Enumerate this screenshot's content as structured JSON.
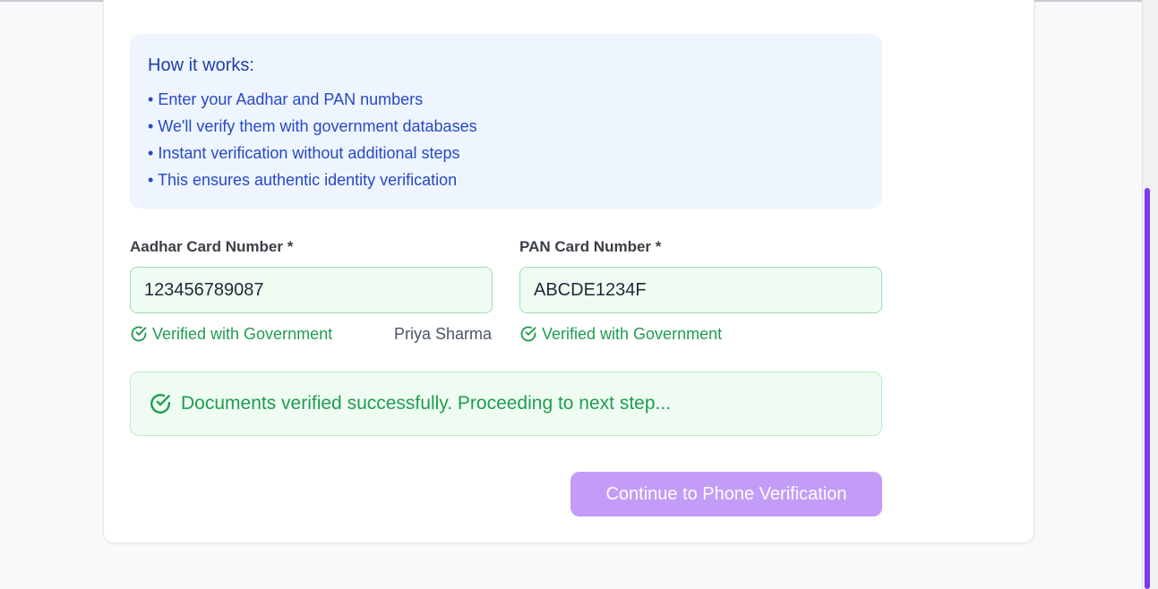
{
  "info": {
    "title": "How it works:",
    "items": [
      "Enter your Aadhar and PAN numbers",
      "We'll verify them with government databases",
      "Instant verification without additional steps",
      "This ensures authentic identity verification"
    ]
  },
  "aadhar": {
    "label": "Aadhar Card Number *",
    "value": "123456789087",
    "status": "Verified with Government",
    "name": "Priya Sharma"
  },
  "pan": {
    "label": "PAN Card Number *",
    "value": "ABCDE1234F",
    "status": "Verified with Government"
  },
  "success": {
    "message": "Documents verified successfully. Proceeding to next step..."
  },
  "actions": {
    "continue_label": "Continue to Phone Verification"
  },
  "colors": {
    "accent": "#c39cf7",
    "success": "#1f9d4f",
    "info": "#2748c6",
    "scroll_thumb": "#7c3aed"
  }
}
